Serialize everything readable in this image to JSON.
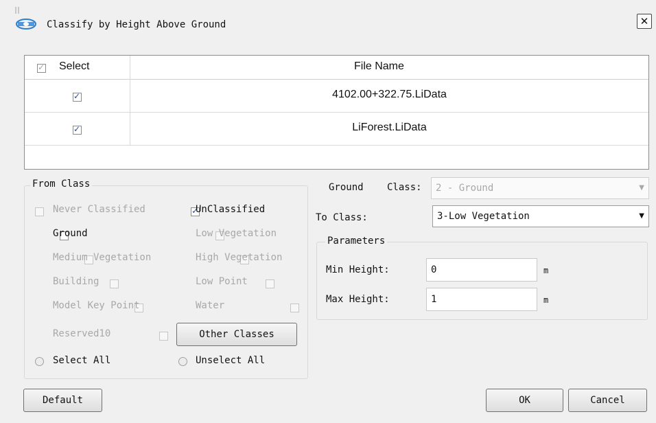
{
  "window": {
    "title": "Classify by Height Above Ground",
    "close_glyph": "✕"
  },
  "file_table": {
    "headers": {
      "select": "Select",
      "file_name": "File Name"
    },
    "select_all_checked": true,
    "rows": [
      {
        "checked": true,
        "file": "4102.00+322.75.LiData"
      },
      {
        "checked": true,
        "file": "LiForest.LiData"
      }
    ]
  },
  "from_class": {
    "legend": "From Class",
    "items": {
      "never": {
        "label": "Never Classified",
        "checked": false,
        "enabled": false
      },
      "unclassified": {
        "label": "UnClassified",
        "checked": true,
        "enabled": true
      },
      "ground": {
        "label": "Ground",
        "checked": false,
        "enabled": true
      },
      "low_veg": {
        "label": "Low Vegetation",
        "checked": false,
        "enabled": false
      },
      "medium_veg": {
        "label": "Medium Vegetation",
        "checked": false,
        "enabled": false
      },
      "high_veg": {
        "label": "High Vegetation",
        "checked": false,
        "enabled": false
      },
      "building": {
        "label": "Building",
        "checked": false,
        "enabled": false
      },
      "low_point": {
        "label": "Low Point",
        "checked": false,
        "enabled": false
      },
      "model_key": {
        "label": "Model Key Point",
        "checked": false,
        "enabled": false
      },
      "water": {
        "label": "Water",
        "checked": false,
        "enabled": false
      },
      "reserved10": {
        "label": "Reserved10",
        "checked": false,
        "enabled": false
      }
    },
    "other_classes_button": "Other Classes",
    "select_all": "Select All",
    "unselect_all": "Unselect All"
  },
  "ground_class": {
    "label_a": "Ground",
    "label_b": "Class:",
    "value": "2 - Ground"
  },
  "to_class": {
    "label": "To Class:",
    "value": "3-Low Vegetation"
  },
  "parameters": {
    "legend": "Parameters",
    "min_label": "Min Height:",
    "min_value": "0",
    "min_unit": "m",
    "max_label": "Max Height:",
    "max_value": "1",
    "max_unit": "m"
  },
  "buttons": {
    "default": "Default",
    "ok": "OK",
    "cancel": "Cancel"
  },
  "colors": {
    "check": "#2c4a9e",
    "logo": "#2a7fd1"
  },
  "icons": {
    "logo": "app-logo-icon",
    "close": "close-icon",
    "dropdown": "chevron-down-icon"
  }
}
